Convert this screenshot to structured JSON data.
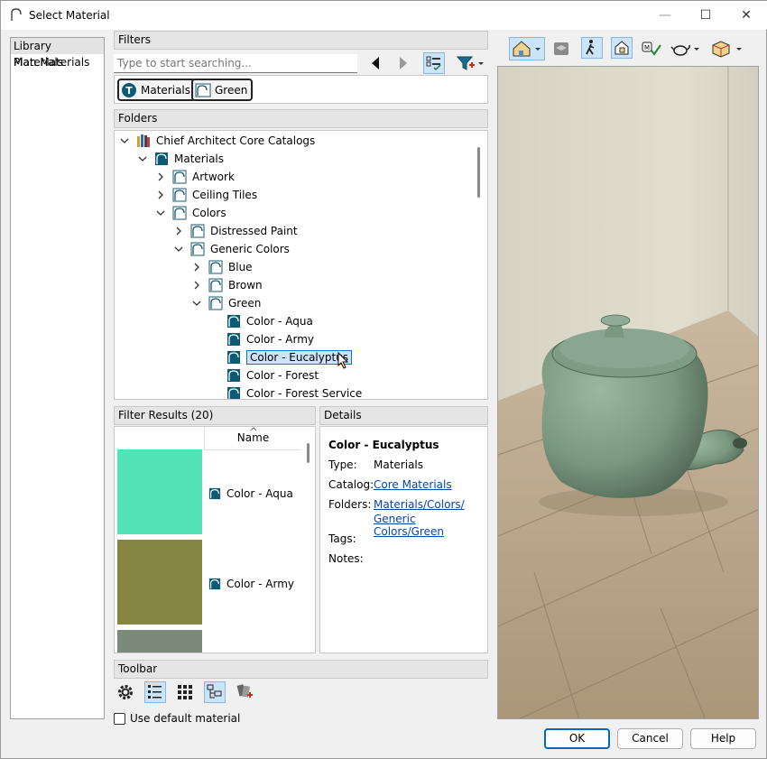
{
  "window": {
    "title": "Select Material",
    "controls": {
      "minimize": "—",
      "maximize": "☐",
      "close": "✕"
    }
  },
  "sidebar": {
    "items": [
      {
        "label": "Library Materials",
        "selected": true
      },
      {
        "label": "Plan Materials",
        "selected": false
      }
    ]
  },
  "filters": {
    "header": "Filters",
    "search_placeholder": "Type to start searching...",
    "tags": [
      {
        "label": "Materials",
        "icon": "materials-type-icon"
      },
      {
        "label": "Green",
        "icon": "folder-icon"
      }
    ]
  },
  "folders": {
    "header": "Folders",
    "items": [
      {
        "label": "Chief Architect Core Catalogs",
        "level": 0,
        "state": "expanded",
        "icon": "catalog-books-icon"
      },
      {
        "label": "Materials",
        "level": 1,
        "state": "expanded",
        "icon": "material-filled-icon"
      },
      {
        "label": "Artwork",
        "level": 2,
        "state": "collapsed",
        "icon": "folder-icon"
      },
      {
        "label": "Ceiling Tiles",
        "level": 2,
        "state": "collapsed",
        "icon": "folder-icon"
      },
      {
        "label": "Colors",
        "level": 2,
        "state": "expanded",
        "icon": "folder-icon"
      },
      {
        "label": "Distressed Paint",
        "level": 3,
        "state": "collapsed",
        "icon": "folder-icon"
      },
      {
        "label": "Generic Colors",
        "level": 3,
        "state": "expanded",
        "icon": "folder-icon"
      },
      {
        "label": "Blue",
        "level": 4,
        "state": "collapsed",
        "icon": "folder-icon"
      },
      {
        "label": "Brown",
        "level": 4,
        "state": "collapsed",
        "icon": "folder-icon"
      },
      {
        "label": "Green",
        "level": 4,
        "state": "expanded",
        "icon": "folder-icon"
      },
      {
        "label": "Color - Aqua",
        "level": 5,
        "state": "leaf",
        "icon": "material-filled-icon"
      },
      {
        "label": "Color - Army",
        "level": 5,
        "state": "leaf",
        "icon": "material-filled-icon"
      },
      {
        "label": "Color - Eucalyptus",
        "level": 5,
        "state": "leaf",
        "icon": "material-filled-icon",
        "selected": true
      },
      {
        "label": "Color - Forest",
        "level": 5,
        "state": "leaf",
        "icon": "material-filled-icon"
      },
      {
        "label": "Color - Forest Service",
        "level": 5,
        "state": "leaf",
        "icon": "material-filled-icon"
      }
    ]
  },
  "results": {
    "header": "Filter Results (20)",
    "column_name": "Name",
    "items": [
      {
        "label": "Color - Aqua",
        "swatch": "#54e3b5"
      },
      {
        "label": "Color - Army",
        "swatch": "#868642"
      },
      {
        "label": "",
        "swatch": "#7c8a7c"
      }
    ]
  },
  "details": {
    "header": "Details",
    "name": "Color - Eucalyptus",
    "type_label": "Type:",
    "type_value": "Materials",
    "catalog_label": "Catalog:",
    "catalog_value": "Core Materials",
    "folders_label": "Folders:",
    "folders_value_1": "Materials/Colors/",
    "folders_value_2": "Generic Colors/Green",
    "tags_label": "Tags:",
    "notes_label": "Notes:"
  },
  "toolbar": {
    "header": "Toolbar",
    "use_default_label": "Use default material"
  },
  "buttons": {
    "ok": "OK",
    "cancel": "Cancel",
    "help": "Help"
  },
  "colors": {
    "accent": "#0078d4",
    "selection": "#cce4f7",
    "material_icon": "#0d5a74",
    "teapot": "#7f9c85"
  }
}
